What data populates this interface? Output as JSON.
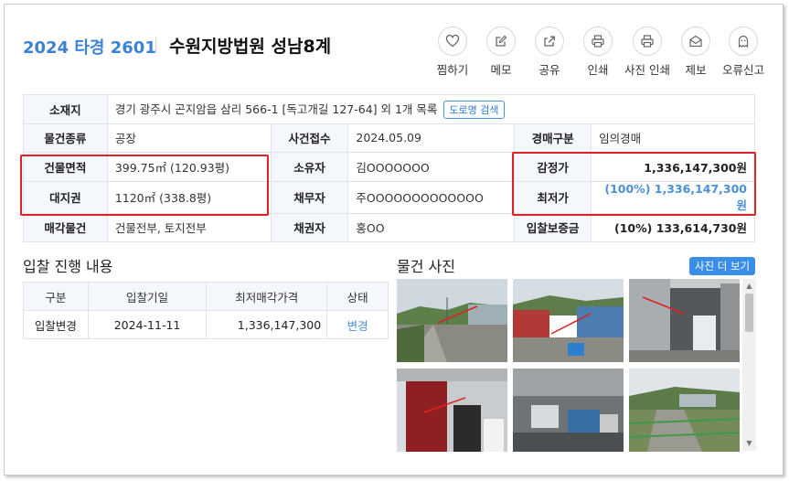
{
  "header": {
    "case_no": "2024 타경 2601",
    "court": "수원지방법원 성남8계"
  },
  "actions": [
    {
      "label": "찜하기",
      "icon": "heart-icon"
    },
    {
      "label": "메모",
      "icon": "memo-icon"
    },
    {
      "label": "공유",
      "icon": "share-icon"
    },
    {
      "label": "인쇄",
      "icon": "print-icon"
    },
    {
      "label": "사진 인쇄",
      "icon": "photo-print-icon"
    },
    {
      "label": "제보",
      "icon": "mail-icon"
    },
    {
      "label": "오류신고",
      "icon": "ghost-icon"
    }
  ],
  "info": {
    "location_label": "소재지",
    "location_value": "경기 광주시 곤지암읍 삼리 566-1 [독고개길 127-64] 외 1개 목록",
    "road_search": "도로명 검색",
    "type_label": "물건종류",
    "type_value": "공장",
    "received_label": "사건접수",
    "received_value": "2024.05.09",
    "auction_type_label": "경매구분",
    "auction_type_value": "임의경매",
    "building_area_label": "건물면적",
    "building_area_value": "399.75㎡ (120.93평)",
    "owner_label": "소유자",
    "owner_value": "김OOOOOOO",
    "appraisal_label": "감정가",
    "appraisal_value": "1,336,147,300원",
    "land_label": "대지권",
    "land_value": "1120㎡ (338.8평)",
    "debtor_label": "채무자",
    "debtor_value": "주OOOOOOOOOOOOO",
    "min_label": "최저가",
    "min_value": "(100%) 1,336,147,300원",
    "sale_label": "매각물건",
    "sale_value": "건물전부, 토지전부",
    "creditor_label": "채권자",
    "creditor_value": "홍OO",
    "deposit_label": "입찰보증금",
    "deposit_value": "(10%) 133,614,730원"
  },
  "bid_section": {
    "title": "입찰 진행 내용",
    "headers": [
      "구분",
      "입찰기일",
      "최저매각가격",
      "상태"
    ],
    "row": {
      "type": "입찰변경",
      "date": "2024-11-11",
      "price": "1,336,147,300",
      "status": "변경"
    }
  },
  "photo_section": {
    "title": "물건 사진",
    "more_button": "사진 더 보기"
  },
  "colors": {
    "accent": "#3b82d6",
    "highlight_box": "#e0202a",
    "min_price": "#4a90d9"
  }
}
